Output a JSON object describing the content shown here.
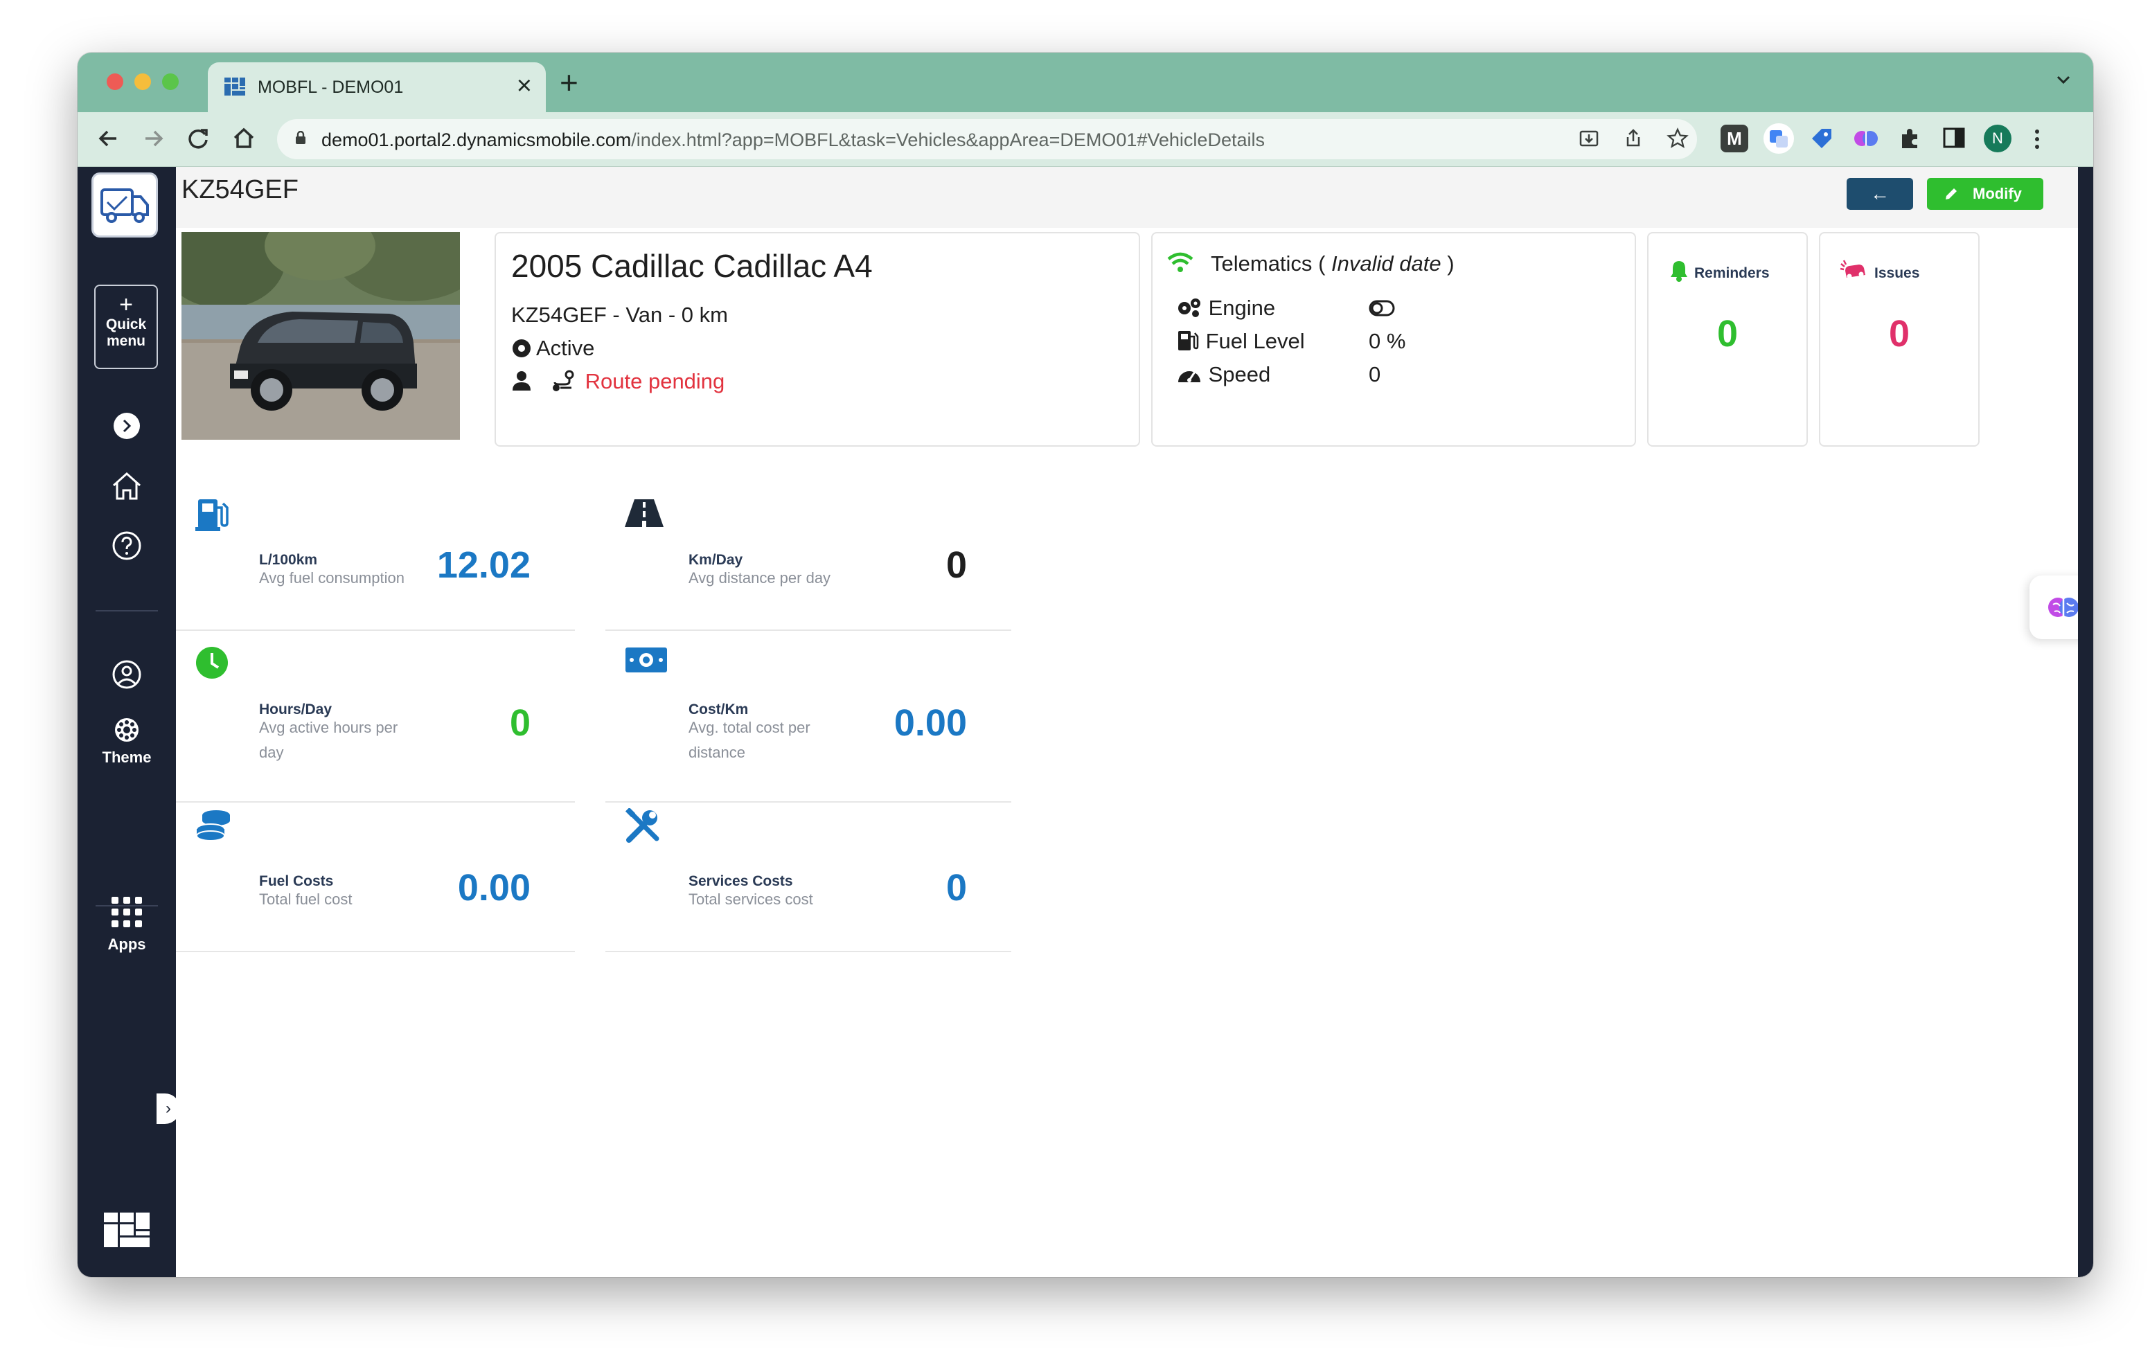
{
  "browser": {
    "tab_title": "MOBFL - DEMO01",
    "tab_close": "×",
    "new_tab": "+",
    "url_host": "demo01.portal2.dynamicsmobile.com",
    "url_path": "/index.html?app=MOBFL&task=Vehicles&appArea=DEMO01#VehicleDetails",
    "ext_m": "M",
    "profile_initial": "N"
  },
  "sidebar": {
    "quick_menu_plus": "+",
    "quick_menu_label1": "Quick",
    "quick_menu_label2": "menu",
    "theme_label": "Theme",
    "apps_label": "Apps"
  },
  "header": {
    "title": "KZ54GEF",
    "back_label": "←",
    "modify_label": "Modify"
  },
  "vehicle": {
    "name": "2005 Cadillac Cadillac A4",
    "details": "KZ54GEF -  Van -  0 km",
    "status": "Active",
    "route_status": "Route pending"
  },
  "telematics": {
    "title": "Telematics",
    "date_open": "(",
    "date_status": "Invalid date",
    "date_close": ")",
    "engine_label": "Engine",
    "fuel_label": "Fuel Level",
    "fuel_value": "0 %",
    "speed_label": "Speed",
    "speed_value": "0"
  },
  "reminders": {
    "title": "Reminders",
    "value": "0"
  },
  "issues": {
    "title": "Issues",
    "value": "0"
  },
  "metrics": {
    "fuel": {
      "label": "L/100km",
      "sub": "Avg fuel consumption",
      "value": "12.02"
    },
    "km_day": {
      "label": "Km/Day",
      "sub": "Avg distance per day",
      "value": "0"
    },
    "hours": {
      "label": "Hours/Day",
      "sub1": "Avg active hours per",
      "sub2": "day",
      "value": "0"
    },
    "cost_km": {
      "label": "Cost/Km",
      "sub1": "Avg. total cost per",
      "sub2": "distance",
      "value": "0.00"
    },
    "fuel_costs": {
      "label": "Fuel Costs",
      "sub": "Total fuel cost",
      "value": "0.00"
    },
    "service_costs": {
      "label": "Services Costs",
      "sub": "Total services cost",
      "value": "0"
    }
  },
  "colors": {
    "sidebar": "#1b2233",
    "blue_value": "#1b78c4",
    "green_value": "#2fbe2f",
    "pink_value": "#e0306a",
    "modify": "#2fbe2f",
    "back": "#1e4d6e"
  }
}
